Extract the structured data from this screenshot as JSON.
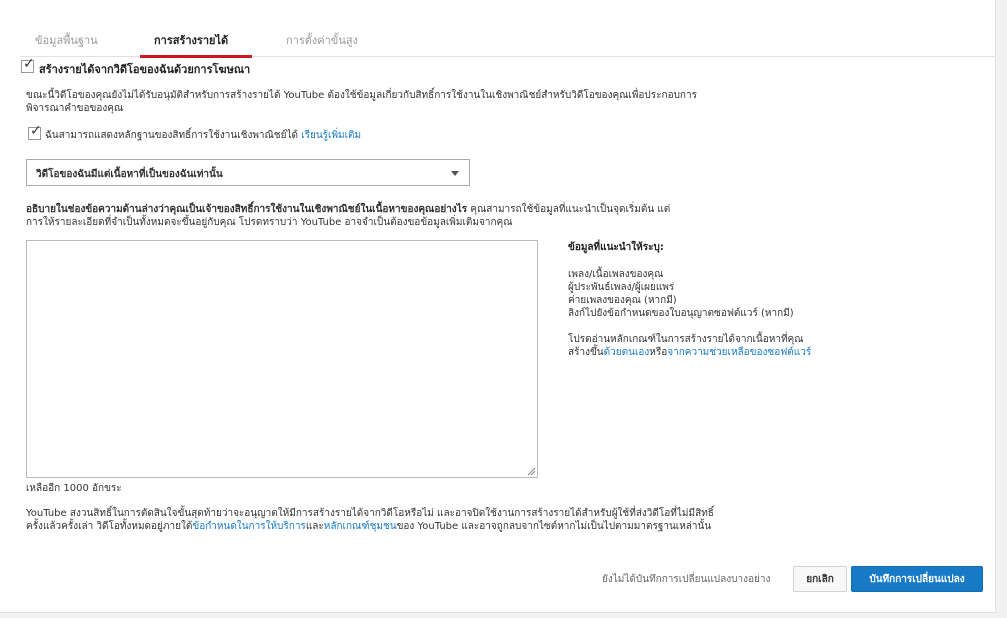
{
  "tabs": [
    {
      "label": "ข้อมูลพื้นฐาน"
    },
    {
      "label": "การสร้างรายได้"
    },
    {
      "label": "การตั้งค่าขั้นสูง"
    }
  ],
  "monetize": {
    "checkbox_label": "สร้างรายได้จากวิดีโอของฉันด้วยการโฆษณา",
    "notice_line1": "ขณะนี้วิดีโอของคุณยังไม่ได้รับอนุมัติสำหรับการสร้างรายได้ YouTube ต้องใช้ข้อมูลเกี่ยวกับสิทธิ์การใช้งานในเชิงพาณิชย์สำหรับวิดีโอของคุณเพื่อประกอบการ",
    "notice_line2": "พิจารณาคำขอของคุณ",
    "rights_checkbox_label": "ฉันสามารถแสดงหลักฐานของสิทธิ์การใช้งานเชิงพาณิชย์ได้",
    "learn_more": "เรียนรู้เพิ่มเติม",
    "content_select_value": "วิดีโอของฉันมีแต่เนื้อหาที่เป็นของฉันเท่านั้น",
    "describe_bold": "อธิบายในช่องข้อความด้านล่างว่าคุณเป็นเจ้าของสิทธิ์การใช้งานในเชิงพาณิชย์ในเนื้อหาของคุณอย่างไร",
    "describe_rest": " คุณสามารถใช้ข้อมูลที่แนะนำเป็นจุดเริ่มต้น แต่",
    "describe_line2": "การให้รายละเอียดที่จำเป็นทั้งหมดจะขึ้นอยู่กับคุณ โปรดทราบว่า YouTube อาจจำเป็นต้องขอข้อมูลเพิ่มเติมจากคุณ",
    "chars_remaining": "เหลืออีก 1000 อักขระ"
  },
  "suggested": {
    "title": "ข้อมูลที่แนะนำให้ระบุ:",
    "items": [
      "เพลง/เนื้อเพลงของคุณ",
      "ผู้ประพันธ์เพลง/ผู้เผยแพร่",
      "ค่ายเพลงของคุณ (หากมี)",
      "ลิงก์ไปยังข้อกำหนดของใบอนุญาตซอฟต์แวร์ (หากมี)"
    ],
    "note_line1": "โปรดอ่านหลักเกณฑ์ในการสร้างรายได้จากเนื้อหาที่คุณ",
    "note_prefix": "สร้างขึ้น",
    "link1": "ด้วยตนเอง",
    "note_mid": "หรือ",
    "link2": "จากความช่วยเหลือของซอฟต์แวร์"
  },
  "footer": {
    "line1": "YouTube สงวนสิทธิ์ในการตัดสินใจขั้นสุดท้ายว่าจะอนุญาตให้มีการสร้างรายได้จากวิดีโอหรือไม่ และอาจปิดใช้งานการสร้างรายได้สำหรับผู้ใช้ที่ส่งวิดีโอที่ไม่มีสิทธิ์",
    "line2_prefix": "ครั้งแล้วครั้งเล่า วิดีโอทั้งหมดอยู่ภายใต้",
    "terms_link": "ข้อกำหนดในการให้บริการ",
    "and": "และ",
    "guidelines_link": "หลักเกณฑ์ชุมชน",
    "line2_suffix": "ของ YouTube และอาจถูกลบจากไซต์หากไม่เป็นไปตามมาตรฐานเหล่านั้น"
  },
  "actions": {
    "unsaved_text": "ยังไม่ได้บันทึกการเปลี่ยนแปลงบางอย่าง",
    "cancel_label": "ยกเลิก",
    "save_label": "บันทึกการเปลี่ยนแปลง"
  }
}
